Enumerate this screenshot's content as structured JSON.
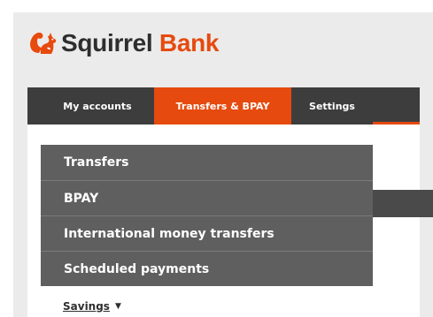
{
  "brand": {
    "name_part1": "Squirrel",
    "name_part2": "Bank",
    "accent_color": "#e64a0e",
    "logo_icon": "squirrel-icon"
  },
  "nav": {
    "items": [
      {
        "label": "My accounts",
        "active": false
      },
      {
        "label": "Transfers & BPAY",
        "active": true
      },
      {
        "label": "Settings",
        "active": false
      }
    ]
  },
  "dropdown": {
    "items": [
      {
        "label": "Transfers"
      },
      {
        "label": "BPAY"
      },
      {
        "label": "International money transfers"
      },
      {
        "label": "Scheduled payments"
      }
    ]
  },
  "account_select": {
    "label": "Savings",
    "icon": "caret-down-icon"
  }
}
